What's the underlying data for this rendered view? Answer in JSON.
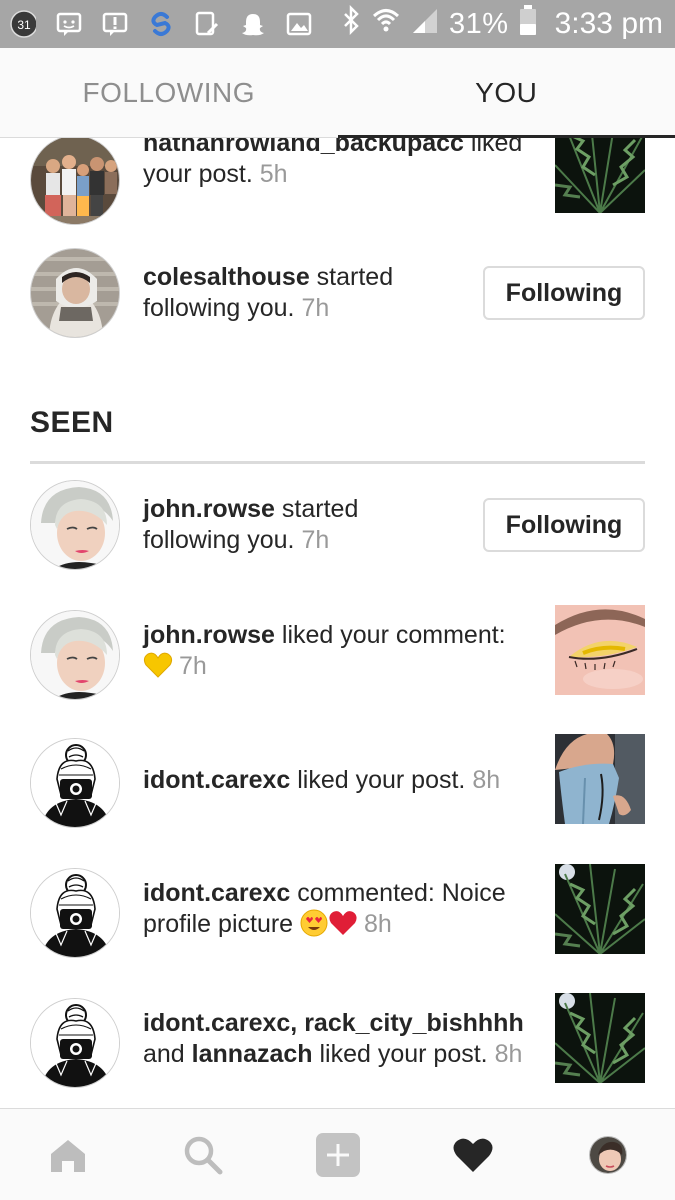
{
  "status_bar": {
    "notification_badge": "31",
    "battery_percent": "31%",
    "time": "3:33 pm"
  },
  "tabs": [
    {
      "label": "FOLLOWING"
    },
    {
      "label": "YOU"
    }
  ],
  "section_seen": "SEEN",
  "items": [
    {
      "user": "nathanrowland_backupacc",
      "action": " liked",
      "action2": "your post.",
      "time": "5h"
    },
    {
      "user": "colesalthouse",
      "action": " started",
      "action2": "following you.",
      "time": "7h",
      "button": "Following"
    },
    {
      "user": "john.rowse",
      "action": " started",
      "action2": "following you.",
      "time": "7h",
      "button": "Following"
    },
    {
      "user": "john.rowse",
      "action": " liked your comment:",
      "time": "7h"
    },
    {
      "user": "idont.carexc",
      "action": " liked your post.",
      "time": "8h"
    },
    {
      "user": "idont.carexc",
      "action": " commented: Noice",
      "action2": "profile picture",
      "time": "8h"
    },
    {
      "user": "idont.carexc",
      "sep1": ", ",
      "user2": "rack_city_bishhhh",
      "and": "and ",
      "user3": "lannazach",
      "action": " liked your post.",
      "time": "8h"
    }
  ],
  "colors": {
    "status_bar": "#a6a6a6",
    "text_primary": "#262626",
    "text_secondary": "#999999",
    "tab_inactive": "#8e8e8e",
    "divider": "#dbdbdb"
  },
  "icons": [
    "home-icon",
    "search-icon",
    "add-icon",
    "heart-icon",
    "profile-avatar"
  ]
}
